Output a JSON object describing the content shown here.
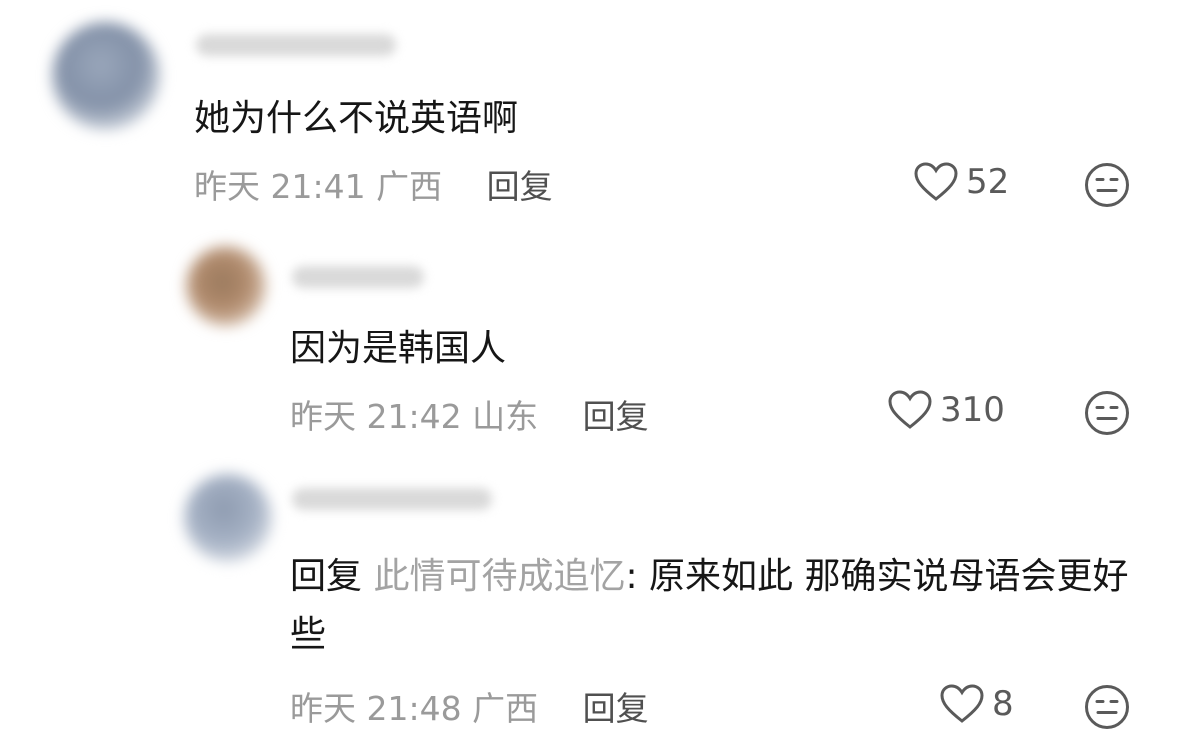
{
  "comments": [
    {
      "content": "她为什么不说英语啊",
      "time": "昨天 21:41",
      "location": "广西",
      "reply_label": "回复",
      "likes": "52"
    },
    {
      "content": "因为是韩国人",
      "time": "昨天 21:42",
      "location": "山东",
      "reply_label": "回复",
      "likes": "310"
    },
    {
      "content_prefix": "回复",
      "reply_to": "此情可待成追忆",
      "content": ": 原来如此 那确实说母语会更好些",
      "time": "昨天 21:48",
      "location": "广西",
      "reply_label": "回复",
      "likes": "8"
    }
  ],
  "icons": {
    "like": "heart-outline-icon",
    "reaction": "neutral-face-icon"
  },
  "colors": {
    "text": "#161616",
    "meta": "#9a9a9a",
    "reply_target": "#a3a3a3",
    "icon": "#5a5a5a"
  }
}
